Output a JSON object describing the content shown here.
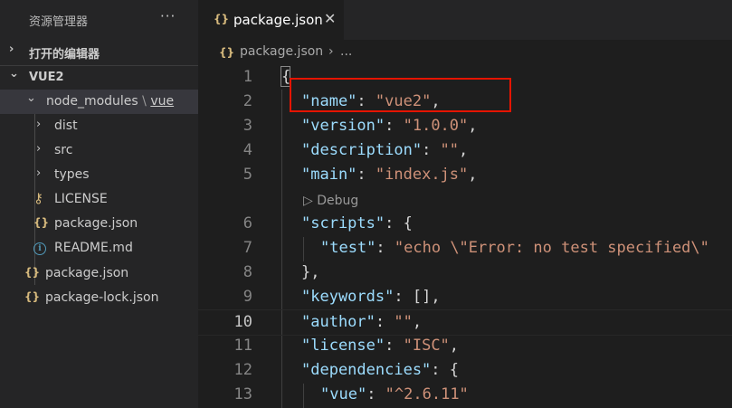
{
  "explorer": {
    "title": "资源管理器",
    "more_label": "···",
    "open_editors_label": "打开的编辑器",
    "workspace_label": "VUE2",
    "tree": [
      {
        "label": "node_modules",
        "sep": "\\",
        "link": "vue",
        "chevron": "﹀",
        "icon": ""
      },
      {
        "label": "dist",
        "chevron": "›",
        "icon": ""
      },
      {
        "label": "src",
        "chevron": "›",
        "icon": ""
      },
      {
        "label": "types",
        "chevron": "›",
        "icon": ""
      },
      {
        "label": "LICENSE",
        "icon": "key-icon"
      },
      {
        "label": "package.json",
        "icon": "json-icon"
      },
      {
        "label": "README.md",
        "icon": "info-icon"
      },
      {
        "label": "package.json",
        "icon": "json-icon"
      },
      {
        "label": "package-lock.json",
        "icon": "json-icon"
      }
    ]
  },
  "tab": {
    "icon_text": "{}",
    "label": "package.json",
    "close": "✕"
  },
  "breadcrumb": {
    "icon_text": "{}",
    "file": "package.json",
    "sep": "›",
    "more": "..."
  },
  "icons": {
    "json_glyph": "{}",
    "key_glyph": "⚷",
    "info_glyph": "i",
    "chevron_right": "›",
    "chevron_down": "⌄"
  },
  "codelens": {
    "label": "▷ Debug"
  },
  "code_lines": [
    {
      "num": "1",
      "text": "{"
    },
    {
      "num": "2",
      "key": "\"name\"",
      "colon": ": ",
      "value": "\"vue2\"",
      "tail": ","
    },
    {
      "num": "3",
      "key": "\"version\"",
      "colon": ": ",
      "value": "\"1.0.0\"",
      "tail": ","
    },
    {
      "num": "4",
      "key": "\"description\"",
      "colon": ": ",
      "value": "\"\"",
      "tail": ","
    },
    {
      "num": "5",
      "key": "\"main\"",
      "colon": ": ",
      "value": "\"index.js\"",
      "tail": ","
    },
    {
      "num": "6",
      "key": "\"scripts\"",
      "colon": ": ",
      "value": "",
      "tail": "{"
    },
    {
      "num": "7",
      "key": "\"test\"",
      "colon": ": ",
      "value": "\"echo \\\"Error: no test specified\\\"",
      "tail": ""
    },
    {
      "num": "8",
      "text": "},"
    },
    {
      "num": "9",
      "key": "\"keywords\"",
      "colon": ": ",
      "value": "",
      "tail": "[],"
    },
    {
      "num": "10",
      "key": "\"author\"",
      "colon": ": ",
      "value": "\"\"",
      "tail": ","
    },
    {
      "num": "11",
      "key": "\"license\"",
      "colon": ": ",
      "value": "\"ISC\"",
      "tail": ","
    },
    {
      "num": "12",
      "key": "\"dependencies\"",
      "colon": ": ",
      "value": "",
      "tail": "{"
    },
    {
      "num": "13",
      "key": "\"vue\"",
      "colon": ": ",
      "value": "\"^2.6.11\"",
      "tail": ""
    }
  ],
  "colors": {
    "key": "#9cdcfe",
    "string": "#ce9178",
    "highlight_box": "#e51400",
    "json_icon": "#d7ba7d"
  }
}
